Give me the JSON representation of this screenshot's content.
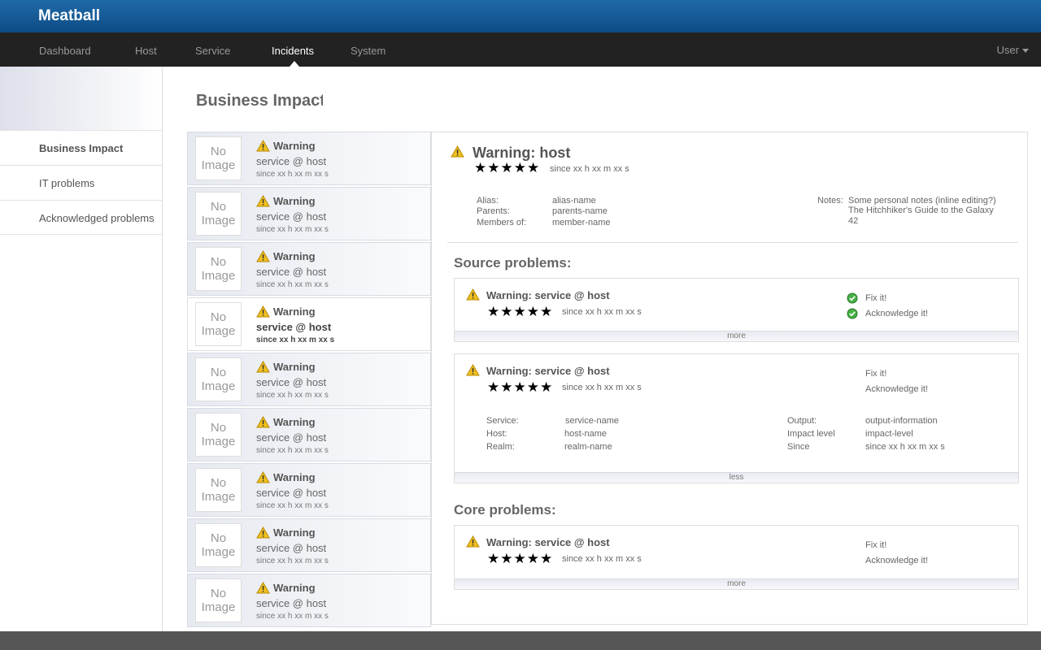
{
  "app": {
    "brand": "Meatball"
  },
  "nav": {
    "items": [
      {
        "label": "Dashboard"
      },
      {
        "label": "Host"
      },
      {
        "label": "Service"
      },
      {
        "label": "Incidents"
      },
      {
        "label": "System"
      }
    ],
    "active": "Incidents",
    "user_label": "User"
  },
  "sidebar": {
    "items": [
      {
        "label": "Business Impact"
      },
      {
        "label": "IT problems"
      },
      {
        "label": "Acknowledged problems"
      }
    ]
  },
  "page": {
    "title": "Business Impact"
  },
  "incident_list": {
    "items": [
      {
        "image": "No Image",
        "title": "Warning",
        "subtitle": "service @ host",
        "since": "since xx h xx m xx s",
        "selected": false
      },
      {
        "image": "No Image",
        "title": "Warning",
        "subtitle": "service @ host",
        "since": "since xx h xx m xx s",
        "selected": false
      },
      {
        "image": "No Image",
        "title": "Warning",
        "subtitle": "service @ host",
        "since": "since xx h xx m xx s",
        "selected": false
      },
      {
        "image": "No Image",
        "title": "Warning",
        "subtitle": "service @ host",
        "since": "since xx h xx m xx s",
        "selected": true
      },
      {
        "image": "No Image",
        "title": "Warning",
        "subtitle": "service @ host",
        "since": "since xx h xx m xx s",
        "selected": false
      },
      {
        "image": "No Image",
        "title": "Warning",
        "subtitle": "service @ host",
        "since": "since xx h xx m xx s",
        "selected": false
      },
      {
        "image": "No Image",
        "title": "Warning",
        "subtitle": "service @ host",
        "since": "since xx h xx m xx s",
        "selected": false
      },
      {
        "image": "No Image",
        "title": "Warning",
        "subtitle": "service @ host",
        "since": "since xx h xx m xx s",
        "selected": false
      },
      {
        "image": "No Image",
        "title": "Warning",
        "subtitle": "service @ host",
        "since": "since xx h xx m xx s",
        "selected": false
      }
    ]
  },
  "detail": {
    "title": "Warning: host",
    "stars": "★★★★★",
    "since": "since xx h xx m xx s",
    "alias_label": "Alias:",
    "alias_value": "alias-name",
    "parents_label": "Parents:",
    "parents_value": "parents-name",
    "members_label": "Members of:",
    "members_value": "member-name",
    "notes_label": "Notes:",
    "notes_lines": [
      "Some personal notes (inline editing?)",
      "The Hitchhiker's Guide to the Galaxy",
      "42"
    ],
    "source_title": "Source problems:",
    "core_title": "Core problems:"
  },
  "source_problems": [
    {
      "title": "Warning: service @ host",
      "stars": "★★★★★",
      "since": "since xx h xx m xx s",
      "fix_label": "Fix it!",
      "ack_label": "Acknowledge it!",
      "toggle": "more",
      "actions_done": true
    },
    {
      "title": "Warning: service @ host",
      "stars": "★★★★★",
      "since": "since xx h xx m xx s",
      "fix_label": "Fix it!",
      "ack_label": "Acknowledge it!",
      "toggle": "less",
      "actions_done": false,
      "service_label": "Service:",
      "service_value": "service-name",
      "host_label": "Host:",
      "host_value": "host-name",
      "realm_label": "Realm:",
      "realm_value": "realm-name",
      "output_label": "Output:",
      "output_value": "output-information",
      "impact_label": "Impact level",
      "impact_value": "impact-level",
      "since_label": "Since",
      "since_value": "since xx h xx m xx s"
    }
  ],
  "core_problems": [
    {
      "title": "Warning: service @ host",
      "stars": "★★★★★",
      "since": "since xx h xx m xx s",
      "fix_label": "Fix it!",
      "ack_label": "Acknowledge it!",
      "toggle": "more"
    }
  ],
  "icons": {
    "warning": "warning-triangle-icon",
    "ok": "check-circle-icon"
  },
  "colors": {
    "header": "#1f6aa8",
    "navbar": "#222222",
    "warning": "#f0c020",
    "ok": "#3aa33a"
  }
}
